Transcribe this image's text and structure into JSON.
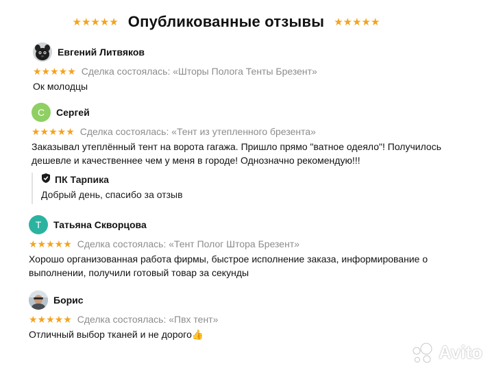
{
  "header": {
    "title": "Опубликованные отзывы",
    "left_stars": "★★★★★",
    "right_stars": "★★★★★"
  },
  "colors": {
    "star": "#f4a31d",
    "muted": "#8c8c8c",
    "avatar_sergey": "#8fcf63",
    "avatar_tatiana": "#2bb3a0"
  },
  "reviews": [
    {
      "author": "Евгений Литвяков",
      "avatar_letter": "",
      "avatar_icon": "dog-photo-avatar",
      "stars": "★★★★★",
      "deal": "Сделка состоялась: «Шторы Полога Тенты Брезент»",
      "text": "Ок молодцы"
    },
    {
      "author": "Сергей",
      "avatar_letter": "С",
      "stars": "★★★★★",
      "deal": "Сделка состоялась: «Тент из утепленного брезента»",
      "text": "Заказывал утеплённый тент на ворота гагажа. Пришло прямо \"ватное одеяло\"! Получилось дешевле и качественнее чем у меня в городе! Однозначно рекомендую!!!"
    },
    {
      "author": "Татьяна Скворцова",
      "avatar_letter": "Т",
      "stars": "★★★★★",
      "deal": "Сделка состоялась: «Тент Полог Штора Брезент»",
      "text": "Хорошо организованная работа фирмы, быстрое исполнение заказа, информирование о выполнении, получили готовый товар за секунды"
    },
    {
      "author": "Борис",
      "avatar_letter": "",
      "avatar_icon": "person-photo-avatar",
      "stars": "★★★★★",
      "deal": "Сделка состоялась: «Пвх тент»",
      "text": "Отличный выбор тканей и не дорого👍"
    }
  ],
  "reply": {
    "name": "ПК Тарпика",
    "text": "Добрый день, спасибо за отзыв",
    "icon": "seller-badge-icon"
  },
  "watermark": {
    "text": "Avito"
  }
}
